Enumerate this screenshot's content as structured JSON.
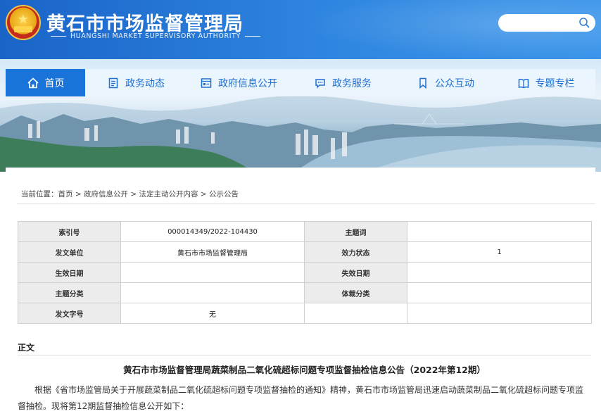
{
  "header": {
    "title": "黄石市市场监督管理局",
    "subtitle": "HUANGSHI MARKET SUPERVISORY AUTHORITY",
    "emblem_icon": "national-emblem-icon",
    "search": {
      "placeholder": "",
      "icon": "search-icon"
    }
  },
  "nav": {
    "items": [
      {
        "label": "首页",
        "icon": "home-icon",
        "active": true
      },
      {
        "label": "政务动态",
        "icon": "document-icon",
        "active": false
      },
      {
        "label": "政府信息公开",
        "icon": "info-board-icon",
        "active": false
      },
      {
        "label": "政务服务",
        "icon": "chat-icon",
        "active": false
      },
      {
        "label": "公众互动",
        "icon": "bookmark-icon",
        "active": false
      },
      {
        "label": "专题专栏",
        "icon": "book-icon",
        "active": false
      }
    ]
  },
  "breadcrumb": {
    "prefix": "当前位置：",
    "items": [
      "首页",
      "政府信息公开",
      "法定主动公开内容",
      "公示公告"
    ],
    "separator": " > "
  },
  "meta_table": {
    "rows": [
      {
        "l1": "索引号",
        "v1": "000014349/2022-104430",
        "l2": "主题词",
        "v2": ""
      },
      {
        "l1": "发文单位",
        "v1": "黄石市市场监督管理局",
        "l2": "效力状态",
        "v2": "1"
      },
      {
        "l1": "生效日期",
        "v1": "",
        "l2": "失效日期",
        "v2": ""
      },
      {
        "l1": "主题分类",
        "v1": "",
        "l2": "体裁分类",
        "v2": ""
      },
      {
        "l1": "发文字号",
        "v1": "无",
        "l2": "",
        "v2": ""
      }
    ]
  },
  "article": {
    "section_label": "正文",
    "title": "黄石市市场监督管理局蔬菜制品二氧化硫超标问题专项监督抽检信息公告（2022年第12期）",
    "paragraph": "根据《省市场监管局关于开展蔬菜制品二氧化硫超标问题专项监督抽检的通知》精神，黄石市市场监管局迅速启动蔬菜制品二氧化硫超标问题专项监督抽检。现将第12期监督抽检信息公开如下："
  },
  "colors": {
    "brand_blue": "#1a73d8",
    "nav_text": "#1f6fd0",
    "table_label_bg": "#ececec"
  }
}
